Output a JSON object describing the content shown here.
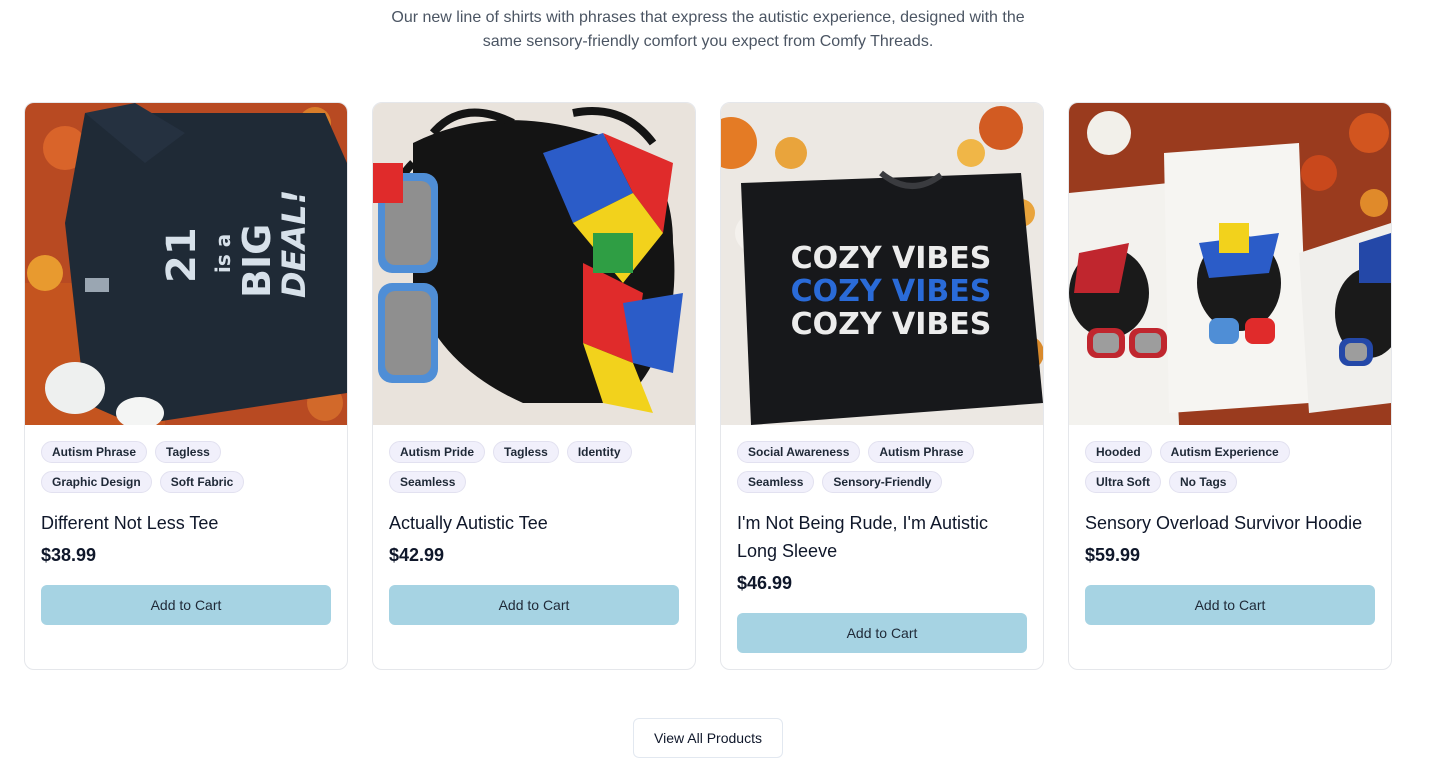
{
  "intro": {
    "line1": "Our new line of shirts with phrases that express the autistic experience, designed with the",
    "line2": "same sensory-friendly comfort you expect from Comfy Threads."
  },
  "products": [
    {
      "title": "Different Not Less Tee",
      "price": "$38.99",
      "tags": [
        "Autism Phrase",
        "Tagless",
        "Graphic Design",
        "Soft Fabric"
      ],
      "button": "Add to Cart",
      "image_icon": "black-tee-21-is-a-big-deal-image",
      "image_text": [
        "21",
        "is a",
        "BIG",
        "DEAL!"
      ]
    },
    {
      "title": "Actually Autistic Tee",
      "price": "$42.99",
      "tags": [
        "Autism Pride",
        "Tagless",
        "Identity",
        "Seamless"
      ],
      "button": "Add to Cart",
      "image_icon": "messy-bun-puzzle-bow-image"
    },
    {
      "title": "I'm Not Being Rude, I'm Autistic Long Sleeve",
      "price": "$46.99",
      "tags": [
        "Social Awareness",
        "Autism Phrase",
        "Seamless",
        "Sensory-Friendly"
      ],
      "button": "Add to Cart",
      "image_icon": "black-tee-cozy-vibes-image",
      "image_text": [
        "COZY VIBES",
        "COZY VIBES",
        "COZY VIBES"
      ]
    },
    {
      "title": "Sensory Overload Survivor Hoodie",
      "price": "$59.99",
      "tags": [
        "Hooded",
        "Autism Experience",
        "Ultra Soft",
        "No Tags"
      ],
      "button": "Add to Cart",
      "image_icon": "white-tees-messy-bun-image"
    }
  ],
  "view_all": "View All Products",
  "colors": {
    "button_bg": "#a6d3e3",
    "tag_bg": "#f1f0fb",
    "card_border": "#e5e7eb"
  }
}
